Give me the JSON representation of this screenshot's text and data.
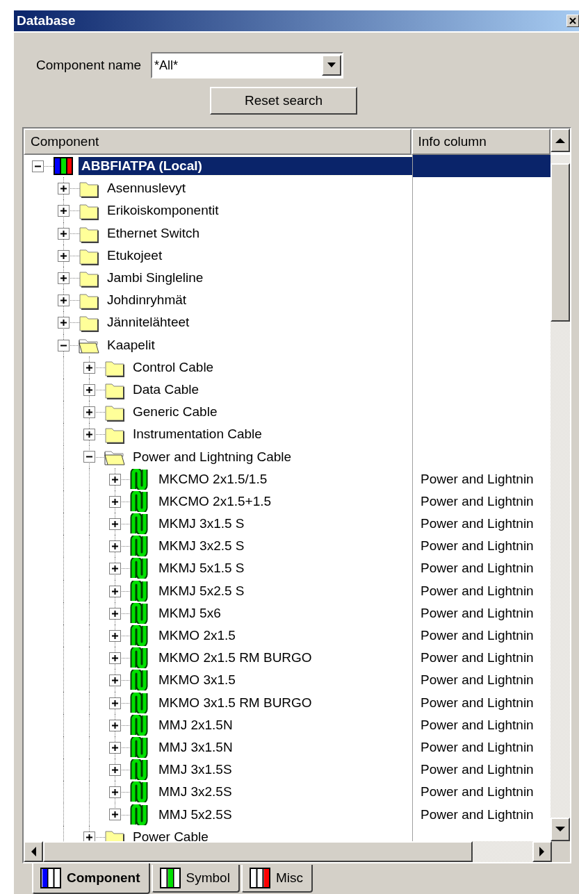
{
  "window": {
    "title": "Database"
  },
  "search": {
    "label": "Component name",
    "value": "*All*",
    "reset_button": "Reset search"
  },
  "tree": {
    "columns": [
      "Component",
      "Info column"
    ],
    "items": [
      {
        "kind": "database",
        "label": "ABBFIATPA (Local)",
        "expanded": true,
        "selected": true,
        "children": [
          {
            "kind": "folder",
            "label": "Asennuslevyt",
            "expanded": false,
            "selected": false
          },
          {
            "kind": "folder",
            "label": "Erikoiskomponentit",
            "expanded": false,
            "selected": false
          },
          {
            "kind": "folder",
            "label": "Ethernet Switch",
            "expanded": false,
            "selected": false
          },
          {
            "kind": "folder",
            "label": "Etukojeet",
            "expanded": false,
            "selected": false
          },
          {
            "kind": "folder",
            "label": "Jambi Singleline",
            "expanded": false,
            "selected": false
          },
          {
            "kind": "folder",
            "label": "Johdinryhmät",
            "expanded": false,
            "selected": false
          },
          {
            "kind": "folder",
            "label": "Jännitelähteet",
            "expanded": false,
            "selected": false
          },
          {
            "kind": "folder",
            "label": "Kaapelit",
            "expanded": true,
            "selected": false,
            "children": [
              {
                "kind": "folder",
                "label": "Control Cable",
                "expanded": false,
                "selected": false
              },
              {
                "kind": "folder",
                "label": "Data Cable",
                "expanded": false,
                "selected": false
              },
              {
                "kind": "folder",
                "label": "Generic Cable",
                "expanded": false,
                "selected": false
              },
              {
                "kind": "folder",
                "label": "Instrumentation Cable",
                "expanded": false,
                "selected": false
              },
              {
                "kind": "folder",
                "label": "Power and Lightning Cable",
                "expanded": true,
                "selected": false,
                "children": [
                  {
                    "kind": "cable",
                    "label": "MKCMO 2x1.5/1.5",
                    "info": "Power and Lightnin",
                    "expanded": false,
                    "selected": false
                  },
                  {
                    "kind": "cable",
                    "label": "MKCMO 2x1.5+1.5",
                    "info": "Power and Lightnin",
                    "expanded": false,
                    "selected": false
                  },
                  {
                    "kind": "cable",
                    "label": "MKMJ 3x1.5 S",
                    "info": "Power and Lightnin",
                    "expanded": false,
                    "selected": false
                  },
                  {
                    "kind": "cable",
                    "label": "MKMJ 3x2.5 S",
                    "info": "Power and Lightnin",
                    "expanded": false,
                    "selected": false
                  },
                  {
                    "kind": "cable",
                    "label": "MKMJ 5x1.5 S",
                    "info": "Power and Lightnin",
                    "expanded": false,
                    "selected": false
                  },
                  {
                    "kind": "cable",
                    "label": "MKMJ 5x2.5 S",
                    "info": "Power and Lightnin",
                    "expanded": false,
                    "selected": false
                  },
                  {
                    "kind": "cable",
                    "label": "MKMJ 5x6",
                    "info": "Power and Lightnin",
                    "expanded": false,
                    "selected": false
                  },
                  {
                    "kind": "cable",
                    "label": "MKMO 2x1.5",
                    "info": "Power and Lightnin",
                    "expanded": false,
                    "selected": false
                  },
                  {
                    "kind": "cable",
                    "label": "MKMO 2x1.5 RM BURGO",
                    "info": "Power and Lightnin",
                    "expanded": false,
                    "selected": false
                  },
                  {
                    "kind": "cable",
                    "label": "MKMO 3x1.5",
                    "info": "Power and Lightnin",
                    "expanded": false,
                    "selected": false
                  },
                  {
                    "kind": "cable",
                    "label": "MKMO 3x1.5 RM BURGO",
                    "info": "Power and Lightnin",
                    "expanded": false,
                    "selected": false
                  },
                  {
                    "kind": "cable",
                    "label": "MMJ 2x1.5N",
                    "info": "Power and Lightnin",
                    "expanded": false,
                    "selected": false
                  },
                  {
                    "kind": "cable",
                    "label": "MMJ 3x1.5N",
                    "info": "Power and Lightnin",
                    "expanded": false,
                    "selected": false
                  },
                  {
                    "kind": "cable",
                    "label": "MMJ 3x1.5S",
                    "info": "Power and Lightnin",
                    "expanded": false,
                    "selected": false
                  },
                  {
                    "kind": "cable",
                    "label": "MMJ 3x2.5S",
                    "info": "Power and Lightnin",
                    "expanded": false,
                    "selected": false
                  },
                  {
                    "kind": "cable",
                    "label": "MMJ 5x2.5S",
                    "info": "Power and Lightnin",
                    "expanded": false,
                    "selected": false
                  }
                ]
              },
              {
                "kind": "folder",
                "label": "Power Cable",
                "expanded": false,
                "selected": false
              }
            ]
          }
        ]
      }
    ]
  },
  "tabs": [
    {
      "label": "Component",
      "selected": true,
      "color": "#0000ff"
    },
    {
      "label": "Symbol",
      "selected": false,
      "color": "#00e000"
    },
    {
      "label": "Misc",
      "selected": false,
      "color": "#ff0000"
    }
  ]
}
